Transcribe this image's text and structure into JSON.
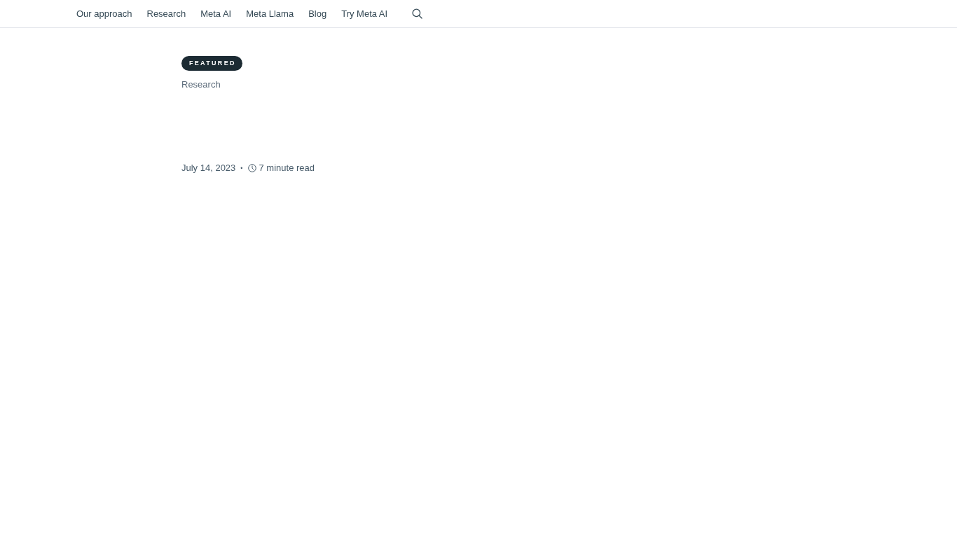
{
  "nav": {
    "links": [
      "Our approach",
      "Research",
      "Meta AI",
      "Meta Llama",
      "Blog",
      "Try Meta AI"
    ]
  },
  "post": {
    "badge": "FEATURED",
    "category": "Research",
    "date": "July 14, 2023",
    "separator": "•",
    "read_time": "7 minute read"
  }
}
